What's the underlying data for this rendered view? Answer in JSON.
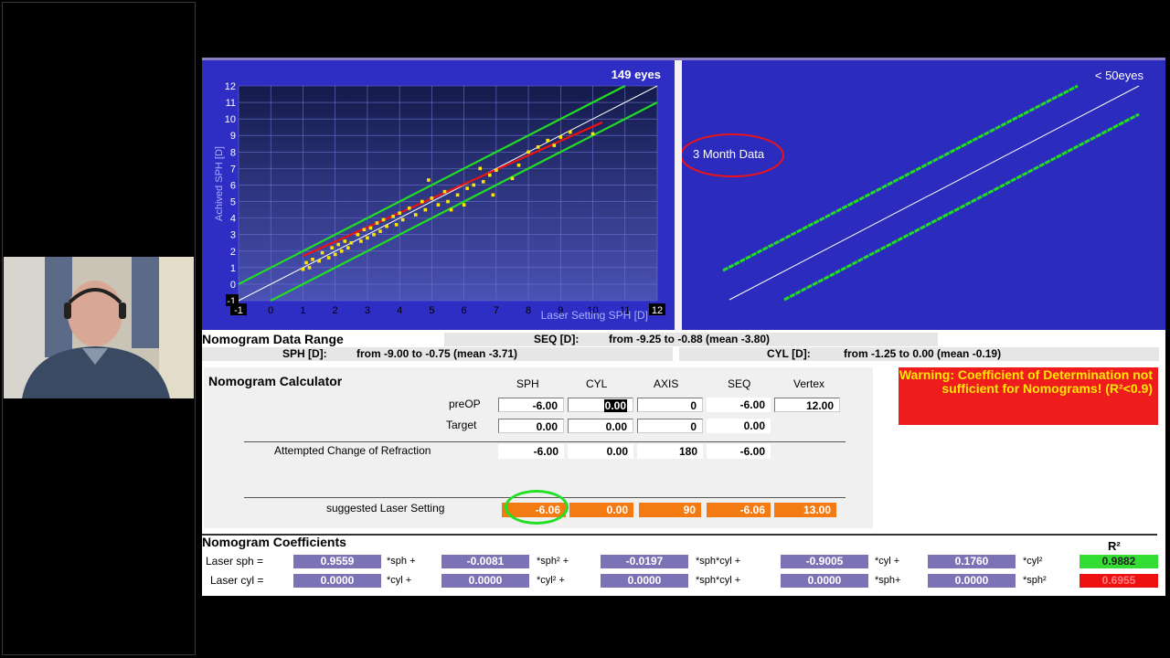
{
  "charts": {
    "left": {
      "count_label": "149 eyes",
      "y_axis_label": "Achived SPH [D]",
      "x_axis_label": "Laser Setting SPH [D]",
      "y_ticks": [
        "12",
        "11",
        "10",
        "9",
        "8",
        "7",
        "6",
        "5",
        "4",
        "3",
        "2",
        "1",
        "0",
        "-1"
      ],
      "x_ticks": [
        "-1",
        "0",
        "1",
        "2",
        "3",
        "4",
        "5",
        "6",
        "7",
        "8",
        "9",
        "10",
        "11",
        "12"
      ]
    },
    "right": {
      "count_label": "< 50eyes",
      "annotation": "3 Month Data"
    }
  },
  "chart_data": {
    "type": "scatter",
    "title": "",
    "xlabel": "Laser Setting SPH [D]",
    "ylabel": "Achived SPH [D]",
    "xlim": [
      -1,
      12
    ],
    "ylim": [
      -1,
      12
    ],
    "grid": true,
    "series": [
      {
        "name": "",
        "points": [
          [
            1.0,
            0.9
          ],
          [
            1.1,
            1.3
          ],
          [
            1.2,
            1.0
          ],
          [
            1.3,
            1.5
          ],
          [
            1.5,
            1.4
          ],
          [
            1.6,
            1.9
          ],
          [
            1.8,
            1.6
          ],
          [
            1.9,
            2.2
          ],
          [
            2.0,
            1.8
          ],
          [
            2.1,
            2.4
          ],
          [
            2.2,
            2.0
          ],
          [
            2.3,
            2.6
          ],
          [
            2.4,
            2.2
          ],
          [
            2.5,
            2.5
          ],
          [
            2.7,
            3.0
          ],
          [
            2.8,
            2.6
          ],
          [
            2.9,
            3.3
          ],
          [
            3.0,
            2.8
          ],
          [
            3.1,
            3.4
          ],
          [
            3.2,
            3.0
          ],
          [
            3.3,
            3.7
          ],
          [
            3.4,
            3.2
          ],
          [
            3.5,
            3.9
          ],
          [
            3.6,
            3.5
          ],
          [
            3.8,
            4.1
          ],
          [
            3.9,
            3.6
          ],
          [
            4.0,
            4.3
          ],
          [
            4.1,
            3.9
          ],
          [
            4.3,
            4.6
          ],
          [
            4.5,
            4.2
          ],
          [
            4.7,
            5.0
          ],
          [
            4.8,
            4.5
          ],
          [
            4.9,
            6.3
          ],
          [
            5.0,
            5.2
          ],
          [
            5.2,
            4.8
          ],
          [
            5.4,
            5.6
          ],
          [
            5.5,
            5.0
          ],
          [
            5.6,
            4.5
          ],
          [
            5.8,
            5.4
          ],
          [
            6.0,
            4.8
          ],
          [
            6.1,
            5.8
          ],
          [
            6.3,
            6.0
          ],
          [
            6.5,
            7.0
          ],
          [
            6.6,
            6.2
          ],
          [
            6.8,
            6.6
          ],
          [
            6.9,
            5.4
          ],
          [
            7.0,
            6.9
          ],
          [
            7.5,
            6.4
          ],
          [
            7.7,
            7.2
          ],
          [
            8.0,
            8.0
          ],
          [
            8.3,
            8.3
          ],
          [
            8.6,
            8.7
          ],
          [
            8.8,
            8.4
          ],
          [
            9.0,
            8.9
          ],
          [
            9.3,
            9.2
          ],
          [
            10.0,
            9.1
          ]
        ]
      },
      {
        "name": "",
        "type": "line",
        "points": [
          [
            -1,
            -1
          ],
          [
            12,
            12
          ]
        ],
        "color": "#ffffff"
      },
      {
        "name": "",
        "type": "line",
        "points": [
          [
            -1,
            0
          ],
          [
            11,
            12
          ]
        ],
        "color": "#22dd22"
      },
      {
        "name": "",
        "type": "line",
        "points": [
          [
            0,
            -1
          ],
          [
            12,
            11
          ]
        ],
        "color": "#22dd22"
      },
      {
        "name": "",
        "type": "line",
        "points": [
          [
            1,
            1.7
          ],
          [
            10.3,
            9.8
          ]
        ],
        "color": "#ee1111"
      }
    ]
  },
  "data_range": {
    "title": "Nomogram Data Range",
    "seq_label": "SEQ [D]:",
    "seq_value": "from -9.25 to -0.88 (mean -3.80)",
    "sph_label": "SPH [D]:",
    "sph_value": "from -9.00 to -0.75 (mean -3.71)",
    "cyl_label": "CYL [D]:",
    "cyl_value": "from -1.25 to 0.00 (mean -0.19)"
  },
  "calculator": {
    "title": "Nomogram Calculator",
    "columns": [
      "SPH",
      "CYL",
      "AXIS",
      "SEQ",
      "Vertex"
    ],
    "rows": {
      "preop": {
        "label": "preOP",
        "sph": "-6.00",
        "cyl": "0.00",
        "axis": "0",
        "seq": "-6.00",
        "vertex": "12.00"
      },
      "target": {
        "label": "Target",
        "sph": "0.00",
        "cyl": "0.00",
        "axis": "0",
        "seq": "0.00"
      },
      "attempted": {
        "label": "Attempted Change of Refraction",
        "sph": "-6.00",
        "cyl": "0.00",
        "axis": "180",
        "seq": "-6.00"
      },
      "suggested": {
        "label": "suggested Laser Setting",
        "sph": "-6.06",
        "cyl": "0.00",
        "axis": "90",
        "seq": "-6.06",
        "vertex": "13.00"
      }
    }
  },
  "warning": {
    "text": "Warning: Coefficient of Determination not sufficient for Nomograms! (R²<0.9)",
    "color": "#ee1c1c"
  },
  "coefficients": {
    "title": "Nomogram Coefficients",
    "r2_header": "R²",
    "sph_row": {
      "label": "Laser sph =",
      "c": [
        "0.9559",
        "-0.0081",
        "-0.0197",
        "-0.9005",
        "0.1760"
      ],
      "ops": [
        "*sph +",
        "*sph² +",
        "*sph*cyl +",
        "*cyl +",
        "*cyl²"
      ],
      "r2": "0.9882",
      "r2_color": "#33dd33"
    },
    "cyl_row": {
      "label": "Laser cyl =",
      "c": [
        "0.0000",
        "0.0000",
        "0.0000",
        "0.0000",
        "0.0000"
      ],
      "ops": [
        "*cyl +",
        "*cyl² +",
        "*sph*cyl +",
        "*sph+",
        "*sph²"
      ],
      "r2": "0.6955",
      "r2_color": "#ee1111"
    }
  }
}
